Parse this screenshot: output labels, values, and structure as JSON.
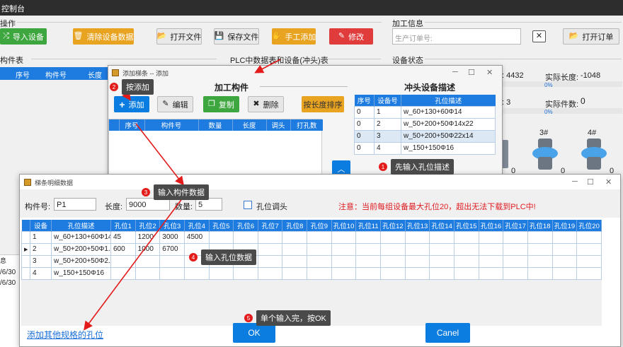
{
  "main_window": {
    "title": "控制台",
    "section_ops": "操作",
    "btn_import": "导入设备",
    "btn_clear": "清除设备数据",
    "btn_open_file": "打开文件",
    "btn_save_file": "保存文件",
    "btn_manual_add": "手工添加",
    "btn_modify": "修改",
    "section_process": "加工信息",
    "order_placeholder": "生产订单号:",
    "btn_open_order": "打开订单",
    "left_table_title": "构件表",
    "left_cols": [
      "序号",
      "构件号",
      "长度"
    ],
    "plc_title": "PLC中数据表和设备(冲头)表",
    "status_title": "设备状态",
    "status_val1": ": 4432",
    "actual_len_label": "实际长度:",
    "actual_len_value": "-1048",
    "pct1": "0%",
    "status_val2": ": 3",
    "actual_count_label": "实际件数:",
    "actual_count_value": "0",
    "pct2": "0%",
    "dev3_label": "3#",
    "dev4_label": "4#",
    "dev_count_a": "0",
    "dev_count_b": "0",
    "dev_count_c": "0",
    "side_label": "息",
    "dates": [
      "/6/30",
      "/6/30"
    ]
  },
  "add_dialog": {
    "title": "添加梯条 -- 添加",
    "section_title": "加工构件",
    "btn_add": "添加",
    "btn_edit": "编辑",
    "btn_copy": "复制",
    "btn_delete": "删除",
    "btn_sort": "按长度排序",
    "cols": [
      "序号",
      "构件号",
      "数量",
      "长度",
      "调头",
      "打孔数"
    ],
    "punch_title": "冲头设备描述",
    "punch_cols": [
      "序号",
      "设备号",
      "孔位描述"
    ],
    "punch_rows": [
      [
        "0",
        "1",
        "w_60+130+60Φ14"
      ],
      [
        "0",
        "2",
        "w_50+200+50Φ14x22"
      ],
      [
        "0",
        "3",
        "w_50+200+50Φ22x14"
      ],
      [
        "0",
        "4",
        "w_150+150Φ16"
      ]
    ]
  },
  "detail_dialog": {
    "title": "梯条明细数据",
    "part_label": "构件号:",
    "part_value": "P1",
    "length_label": "长度:",
    "length_value": "9000",
    "qty_label": "数量:",
    "qty_value": "5",
    "turn_label": "孔位调头",
    "note": "注意：当前每组设备最大孔位20，超出无法下载到PLC中!",
    "grid_cols": [
      "设备",
      "孔位描述",
      "孔位1",
      "孔位2",
      "孔位3",
      "孔位4",
      "孔位5",
      "孔位6",
      "孔位7",
      "孔位8",
      "孔位9",
      "孔位10",
      "孔位11",
      "孔位12",
      "孔位13",
      "孔位14",
      "孔位15",
      "孔位16",
      "孔位17",
      "孔位18",
      "孔位19",
      "孔位20"
    ],
    "grid_rows": [
      [
        "1",
        "w_60+130+60Φ14",
        "45",
        "1200",
        "3000",
        "4500",
        "",
        "",
        "",
        "",
        "",
        "",
        "",
        "",
        "",
        "",
        "",
        "",
        "",
        "",
        "",
        ""
      ],
      [
        "2",
        "w_50+200+50Φ1...",
        "600",
        "1000",
        "6700",
        "",
        "",
        "",
        "",
        "",
        "",
        "",
        "",
        "",
        "",
        "",
        "",
        "",
        "",
        "",
        "",
        ""
      ],
      [
        "3",
        "w_50+200+50Φ2...",
        "",
        "",
        "",
        "",
        "",
        "",
        "",
        "",
        "",
        "",
        "",
        "",
        "",
        "",
        "",
        "",
        "",
        "",
        "",
        ""
      ],
      [
        "4",
        "w_150+150Φ16",
        "",
        "",
        "",
        "",
        "",
        "",
        "",
        "",
        "",
        "",
        "",
        "",
        "",
        "",
        "",
        "",
        "",
        "",
        "",
        ""
      ]
    ],
    "link_other": "添加其他规格的孔位",
    "btn_ok": "OK",
    "btn_cancel": "Canel"
  },
  "callouts": [
    {
      "num": "1",
      "text": "先输入孔位描述"
    },
    {
      "num": "2",
      "text": "按添加"
    },
    {
      "num": "3",
      "text": "输入构件数据"
    },
    {
      "num": "4",
      "text": "输入孔位数据"
    },
    {
      "num": "5",
      "text": "单个输入完，按OK"
    }
  ],
  "colors": {
    "accent": "#0b7de0",
    "header_blue": "#1e7ce0",
    "orange": "#e8a321",
    "green": "#3ea63e",
    "red": "#e03c3c",
    "link": "#1a6fd8"
  }
}
